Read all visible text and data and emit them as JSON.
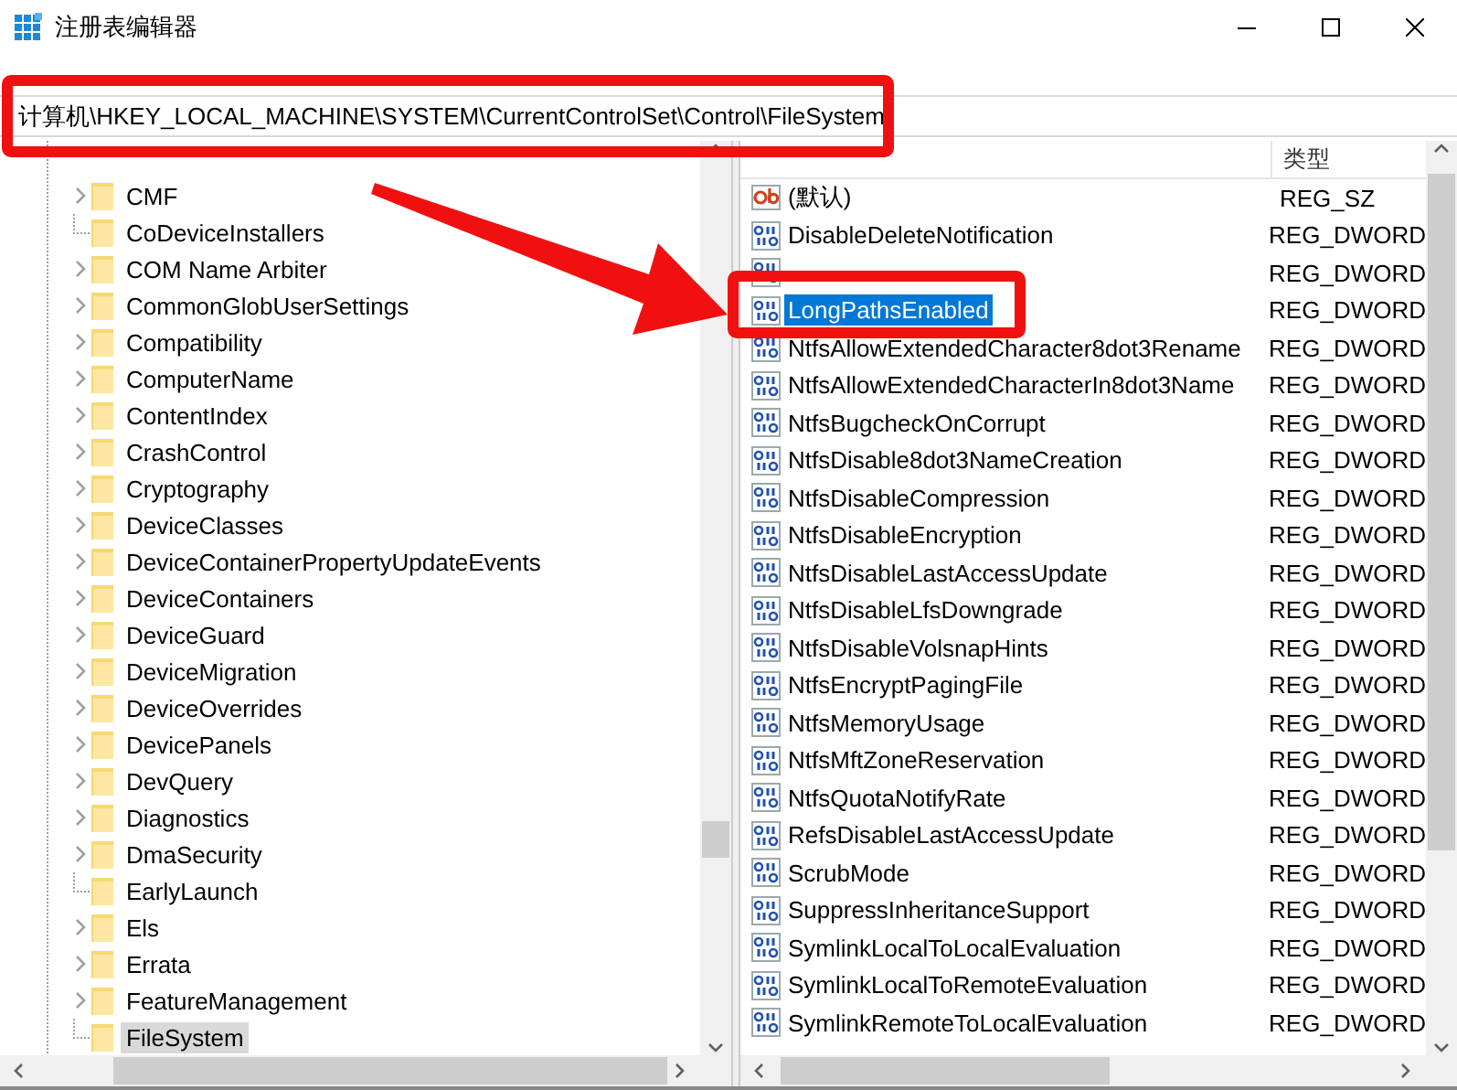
{
  "window": {
    "title": "注册表编辑器"
  },
  "address": "计算机\\HKEY_LOCAL_MACHINE\\SYSTEM\\CurrentControlSet\\Control\\FileSystem",
  "tree": [
    {
      "label": "CMF",
      "expandable": true,
      "selected": false
    },
    {
      "label": "CoDeviceInstallers",
      "expandable": false,
      "selected": false
    },
    {
      "label": "COM Name Arbiter",
      "expandable": true,
      "selected": false
    },
    {
      "label": "CommonGlobUserSettings",
      "expandable": true,
      "selected": false
    },
    {
      "label": "Compatibility",
      "expandable": true,
      "selected": false
    },
    {
      "label": "ComputerName",
      "expandable": true,
      "selected": false
    },
    {
      "label": "ContentIndex",
      "expandable": true,
      "selected": false
    },
    {
      "label": "CrashControl",
      "expandable": true,
      "selected": false
    },
    {
      "label": "Cryptography",
      "expandable": true,
      "selected": false
    },
    {
      "label": "DeviceClasses",
      "expandable": true,
      "selected": false
    },
    {
      "label": "DeviceContainerPropertyUpdateEvents",
      "expandable": true,
      "selected": false
    },
    {
      "label": "DeviceContainers",
      "expandable": true,
      "selected": false
    },
    {
      "label": "DeviceGuard",
      "expandable": true,
      "selected": false
    },
    {
      "label": "DeviceMigration",
      "expandable": true,
      "selected": false
    },
    {
      "label": "DeviceOverrides",
      "expandable": true,
      "selected": false
    },
    {
      "label": "DevicePanels",
      "expandable": true,
      "selected": false
    },
    {
      "label": "DevQuery",
      "expandable": true,
      "selected": false
    },
    {
      "label": "Diagnostics",
      "expandable": true,
      "selected": false
    },
    {
      "label": "DmaSecurity",
      "expandable": true,
      "selected": false
    },
    {
      "label": "EarlyLaunch",
      "expandable": false,
      "selected": false
    },
    {
      "label": "Els",
      "expandable": true,
      "selected": false
    },
    {
      "label": "Errata",
      "expandable": true,
      "selected": false
    },
    {
      "label": "FeatureManagement",
      "expandable": true,
      "selected": false
    },
    {
      "label": "FileSystem",
      "expandable": false,
      "selected": true
    }
  ],
  "values": {
    "type_header": "类型",
    "rows": [
      {
        "name": "(默认)",
        "type": "REG_SZ",
        "kind": "string",
        "selected": false
      },
      {
        "name": "DisableDeleteNotification",
        "type": "REG_DWORD",
        "kind": "dword",
        "selected": false
      },
      {
        "type": "REG_DWORD",
        "kind": "dword",
        "selected": false
      },
      {
        "name": "LongPathsEnabled",
        "type": "REG_DWORD",
        "kind": "dword",
        "selected": true
      },
      {
        "name": "NtfsAllowExtendedCharacter8dot3Rename",
        "type": "REG_DWORD",
        "kind": "dword",
        "selected": false
      },
      {
        "name": "NtfsAllowExtendedCharacterIn8dot3Name",
        "type": "REG_DWORD",
        "kind": "dword",
        "selected": false
      },
      {
        "name": "NtfsBugcheckOnCorrupt",
        "type": "REG_DWORD",
        "kind": "dword",
        "selected": false
      },
      {
        "name": "NtfsDisable8dot3NameCreation",
        "type": "REG_DWORD",
        "kind": "dword",
        "selected": false
      },
      {
        "name": "NtfsDisableCompression",
        "type": "REG_DWORD",
        "kind": "dword",
        "selected": false
      },
      {
        "name": "NtfsDisableEncryption",
        "type": "REG_DWORD",
        "kind": "dword",
        "selected": false
      },
      {
        "name": "NtfsDisableLastAccessUpdate",
        "type": "REG_DWORD",
        "kind": "dword",
        "selected": false
      },
      {
        "name": "NtfsDisableLfsDowngrade",
        "type": "REG_DWORD",
        "kind": "dword",
        "selected": false
      },
      {
        "name": "NtfsDisableVolsnapHints",
        "type": "REG_DWORD",
        "kind": "dword",
        "selected": false
      },
      {
        "name": "NtfsEncryptPagingFile",
        "type": "REG_DWORD",
        "kind": "dword",
        "selected": false
      },
      {
        "name": "NtfsMemoryUsage",
        "type": "REG_DWORD",
        "kind": "dword",
        "selected": false
      },
      {
        "name": "NtfsMftZoneReservation",
        "type": "REG_DWORD",
        "kind": "dword",
        "selected": false
      },
      {
        "name": "NtfsQuotaNotifyRate",
        "type": "REG_DWORD",
        "kind": "dword",
        "selected": false
      },
      {
        "name": "RefsDisableLastAccessUpdate",
        "type": "REG_DWORD",
        "kind": "dword",
        "selected": false
      },
      {
        "name": "ScrubMode",
        "type": "REG_DWORD",
        "kind": "dword",
        "selected": false
      },
      {
        "name": "SuppressInheritanceSupport",
        "type": "REG_DWORD",
        "kind": "dword",
        "selected": false
      },
      {
        "name": "SymlinkLocalToLocalEvaluation",
        "type": "REG_DWORD",
        "kind": "dword",
        "selected": false
      },
      {
        "name": "SymlinkLocalToRemoteEvaluation",
        "type": "REG_DWORD",
        "kind": "dword",
        "selected": false
      },
      {
        "name": "SymlinkRemoteToLocalEvaluation",
        "type": "REG_DWORD",
        "kind": "dword",
        "selected": false
      }
    ]
  }
}
